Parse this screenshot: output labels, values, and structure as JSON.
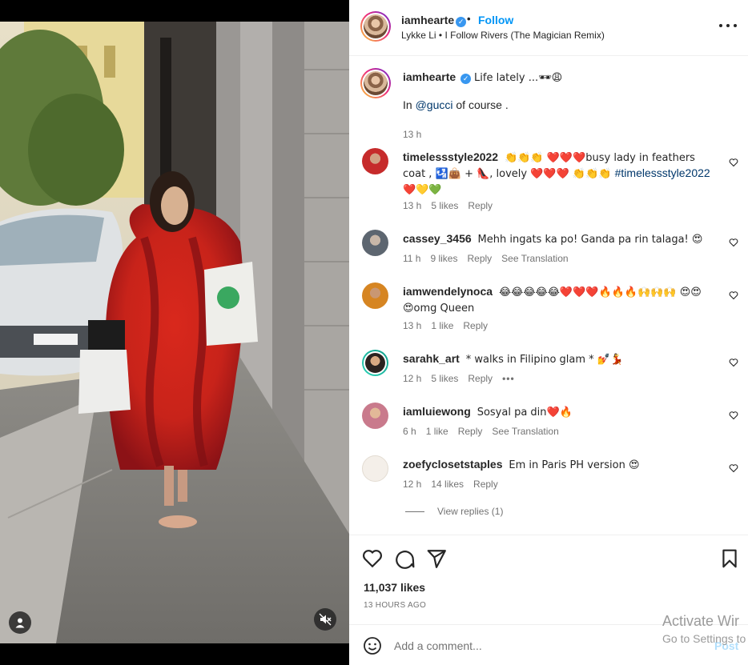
{
  "post": {
    "username": "iamhearte",
    "follow_label": "Follow",
    "separator": "•",
    "audio": "Lykke Li • I Follow Rivers (The Magician Remix)",
    "caption": {
      "username": "iamhearte",
      "text": "Life lately ...🕶😩",
      "line2_prefix": "In ",
      "mention": "@gucci",
      "line2_suffix": " of course .",
      "time": "13 h"
    }
  },
  "comments": [
    {
      "username": "timelessstyle2022",
      "text": "👏👏👏 ❤️❤️❤️busy lady in feathers coat , 🛂👜 + 👠, lovely ❤️❤️❤️ 👏👏👏 ",
      "hashtag": "#timelessstyle2022",
      "text_after": " ❤️💛💚",
      "time": "13 h",
      "likes": "5 likes",
      "reply": "Reply",
      "translate": ""
    },
    {
      "username": "cassey_3456",
      "text": "Mehh ingats ka po! Ganda pa rin talaga! 😍",
      "time": "11 h",
      "likes": "9 likes",
      "reply": "Reply",
      "translate": "See Translation"
    },
    {
      "username": "iamwendelynoca",
      "text": "😂😂😂😂😂❤️❤️❤️🔥🔥🔥🙌🙌🙌 😍😍😍omg Queen",
      "time": "13 h",
      "likes": "1 like",
      "reply": "Reply",
      "translate": ""
    },
    {
      "username": "sarahk_art",
      "text": "* walks in Filipino glam * 💅💃",
      "time": "12 h",
      "likes": "5 likes",
      "reply": "Reply",
      "translate": ""
    },
    {
      "username": "iamluiewong",
      "text": "Sosyal pa din❤️🔥",
      "time": "6 h",
      "likes": "1 like",
      "reply": "Reply",
      "translate": "See Translation"
    },
    {
      "username": "zoefyclosetstaples",
      "text": "Em in Paris PH version 😍",
      "time": "12 h",
      "likes": "14 likes",
      "reply": "Reply",
      "translate": ""
    }
  ],
  "view_replies": "View replies (1)",
  "likes_count": "11,037 likes",
  "post_time": "13 HOURS AGO",
  "comment_box": {
    "placeholder": "Add a comment...",
    "post_label": "Post"
  },
  "watermark": {
    "title": "Activate Wir",
    "subtitle": "Go to Settings to"
  },
  "colors": {
    "accent": "#0095f6",
    "link": "#00376b",
    "muted": "#737373",
    "coat": "#e0301e"
  }
}
